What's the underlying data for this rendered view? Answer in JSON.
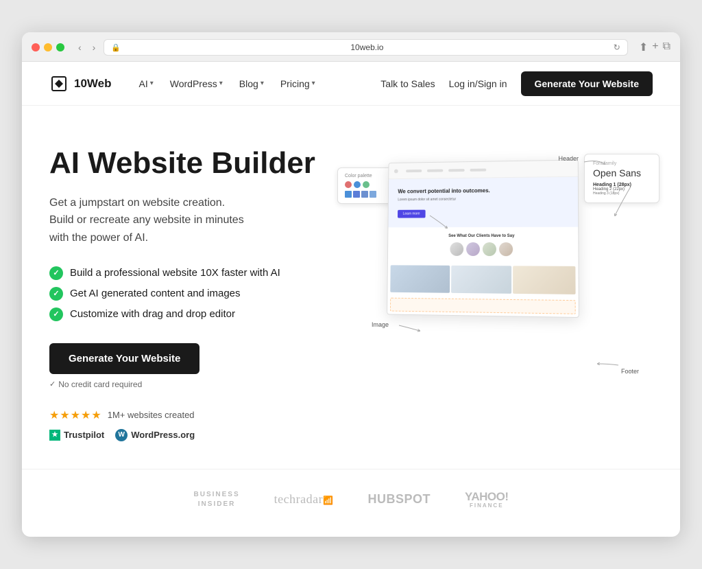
{
  "browser": {
    "url": "10web.io",
    "back_label": "‹",
    "forward_label": "›",
    "refresh_label": "↻",
    "share_label": "⬆",
    "new_tab_label": "+",
    "tabs_label": "⧉"
  },
  "navbar": {
    "logo_text": "10Web",
    "nav_items": [
      {
        "label": "AI",
        "has_dropdown": true
      },
      {
        "label": "WordPress",
        "has_dropdown": true
      },
      {
        "label": "Blog",
        "has_dropdown": true
      },
      {
        "label": "Pricing",
        "has_dropdown": true
      }
    ],
    "talk_to_sales": "Talk to Sales",
    "login": "Log in/Sign in",
    "cta_button": "Generate Your Website"
  },
  "hero": {
    "title": "AI Website Builder",
    "subtitle_line1": "Get a jumpstart on website creation.",
    "subtitle_line2": "Build or recreate any website in minutes",
    "subtitle_line3": "with the power of AI.",
    "features": [
      "Build a professional website 10X faster with AI",
      "Get AI generated content and images",
      "Customize with drag and drop editor"
    ],
    "cta_button": "Generate Your Website",
    "no_credit": "No credit card required",
    "stars": "★★★★★",
    "stars_label": "1M+ websites created",
    "trustpilot": "Trustpilot",
    "wordpress": "WordPress.org"
  },
  "mockup": {
    "hero_text": "We convert potential into outcomes.",
    "hero_sub": "Lorem ipsum dolor sit amet consectetur",
    "clients_title": "See What Our Clients Have to Say",
    "annotations": {
      "header": "Header",
      "font_name": "Open Sans",
      "font_sub": "Font family",
      "heading1": "Heading 1 (28px)",
      "heading2": "Heading 2 (22px)",
      "heading3": "Heading 3 (18px)",
      "image": "Image",
      "footer": "Footer",
      "color_palette": "Color palette"
    }
  },
  "press": {
    "logos": [
      {
        "name": "Business Insider",
        "style": "business-insider"
      },
      {
        "name": "techradar",
        "style": "techradar"
      },
      {
        "name": "HubSpot",
        "style": "hubspot"
      },
      {
        "name": "YAHOO! FINANCE",
        "style": "yahoo"
      }
    ]
  }
}
